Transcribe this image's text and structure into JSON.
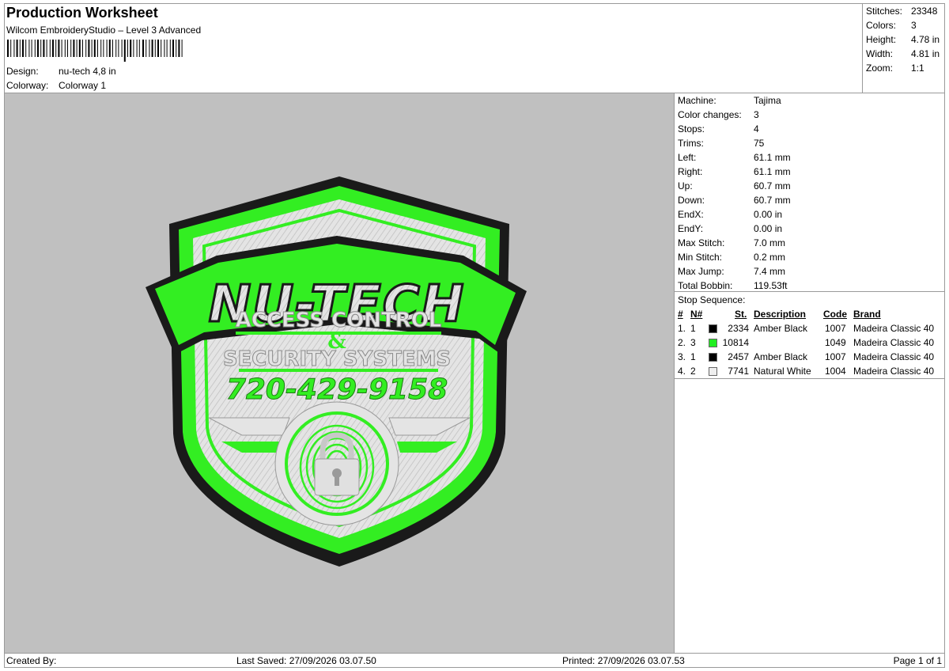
{
  "header": {
    "title": "Production Worksheet",
    "subtitle": "Wilcom EmbroideryStudio – Level 3 Advanced",
    "design_label": "Design:",
    "design_value": "nu-tech 4,8 in",
    "colorway_label": "Colorway:",
    "colorway_value": "Colorway 1"
  },
  "stats": {
    "stitches_label": "Stitches:",
    "stitches_value": "23348",
    "colors_label": "Colors:",
    "colors_value": "3",
    "height_label": "Height:",
    "height_value": "4.78 in",
    "width_label": "Width:",
    "width_value": "4.81 in",
    "zoom_label": "Zoom:",
    "zoom_value": "1:1"
  },
  "machine_info": [
    {
      "label": "Machine:",
      "value": "Tajima"
    },
    {
      "label": "Color changes:",
      "value": "3"
    },
    {
      "label": "Stops:",
      "value": "4"
    },
    {
      "label": "Trims:",
      "value": "75"
    },
    {
      "label": "Left:",
      "value": "61.1 mm"
    },
    {
      "label": "Right:",
      "value": "61.1 mm"
    },
    {
      "label": "Up:",
      "value": "60.7 mm"
    },
    {
      "label": "Down:",
      "value": "60.7 mm"
    },
    {
      "label": "EndX:",
      "value": "0.00 in"
    },
    {
      "label": "EndY:",
      "value": "0.00 in"
    },
    {
      "label": "Max Stitch:",
      "value": "7.0 mm"
    },
    {
      "label": "Min Stitch:",
      "value": "0.2 mm"
    },
    {
      "label": "Max Jump:",
      "value": "7.4 mm"
    },
    {
      "label": "Total Bobbin:",
      "value": "119.53ft"
    }
  ],
  "stop_sequence": {
    "title": "Stop Sequence:",
    "headers": {
      "num": "#",
      "n": "N#",
      "st": "St.",
      "description": "Description",
      "code": "Code",
      "brand": "Brand"
    },
    "rows": [
      {
        "num": "1.",
        "n": "1",
        "color": "#000000",
        "st": "2334",
        "description": "Amber Black",
        "code": "1007",
        "brand": "Madeira Classic 40"
      },
      {
        "num": "2.",
        "n": "3",
        "color": "#22ee22",
        "st": "10814",
        "description": "",
        "code": "1049",
        "brand": "Madeira Classic 40"
      },
      {
        "num": "3.",
        "n": "1",
        "color": "#000000",
        "st": "2457",
        "description": "Amber Black",
        "code": "1007",
        "brand": "Madeira Classic 40"
      },
      {
        "num": "4.",
        "n": "2",
        "color": "#eeeeee",
        "st": "7741",
        "description": "Natural White",
        "code": "1004",
        "brand": "Madeira Classic 40"
      }
    ]
  },
  "design_preview": {
    "logo_title": "NU-TECH",
    "line1": "ACCESS CONTROL",
    "line2": "&",
    "line3": "SECURITY SYSTEMS",
    "phone": "720-429-9158",
    "colors": {
      "green": "#33ee22",
      "black": "#1a1a1a",
      "white": "#e8e8e8",
      "background": "#c0c0c0"
    }
  },
  "footer": {
    "created_by": "Created By:",
    "last_saved": "Last Saved: 27/09/2026 03.07.50",
    "printed": "Printed: 27/09/2026 03.07.53",
    "page": "Page 1 of 1"
  }
}
